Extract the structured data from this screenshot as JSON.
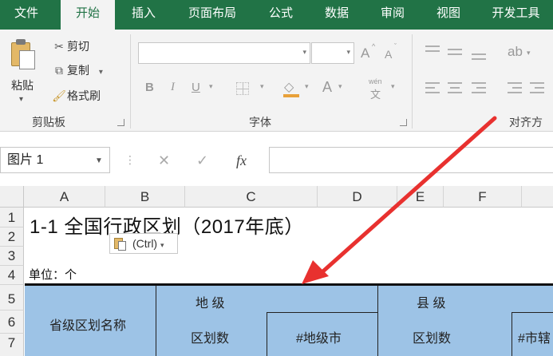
{
  "tabs": [
    {
      "label": "文件",
      "active": false
    },
    {
      "label": "开始",
      "active": true
    },
    {
      "label": "插入",
      "active": false
    },
    {
      "label": "页面布局",
      "active": false
    },
    {
      "label": "公式",
      "active": false
    },
    {
      "label": "数据",
      "active": false
    },
    {
      "label": "审阅",
      "active": false
    },
    {
      "label": "视图",
      "active": false
    },
    {
      "label": "开发工具",
      "active": false
    }
  ],
  "clipboard": {
    "paste": "粘贴",
    "cut": "剪切",
    "copy": "复制",
    "format_painter": "格式刷",
    "group": "剪贴板"
  },
  "font_group": {
    "group": "字体",
    "font_name": "",
    "font_size": "",
    "increase": "A",
    "decrease": "A",
    "bold": "B",
    "italic": "I",
    "underline": "U",
    "font_color": "A",
    "phonetic_top": "wén",
    "phonetic_bottom": "文"
  },
  "align_group": {
    "group": "对齐方式"
  },
  "formula_bar": {
    "name_box": "图片 1",
    "cancel": "✕",
    "enter": "✓",
    "fx": "fx",
    "formula": ""
  },
  "columns": [
    "A",
    "B",
    "C",
    "D",
    "E",
    "F"
  ],
  "rows": [
    "1",
    "2",
    "3",
    "4",
    "5",
    "6",
    "7"
  ],
  "sheet": {
    "title": "1-1    全国行政区划（2017年底）",
    "unit": "单位：个",
    "paste_options": "(Ctrl)",
    "header": {
      "province": "省级区划名称",
      "prefecture": "地 级",
      "prefecture_count": "区划数",
      "prefecture_city": "#地级市",
      "county": "县 级",
      "county_count": "区划数",
      "county_city": "#市辖"
    }
  },
  "colors": {
    "ribbon_green": "#217346",
    "header_fill": "#9dc3e6",
    "arrow_red": "#e8312f"
  }
}
